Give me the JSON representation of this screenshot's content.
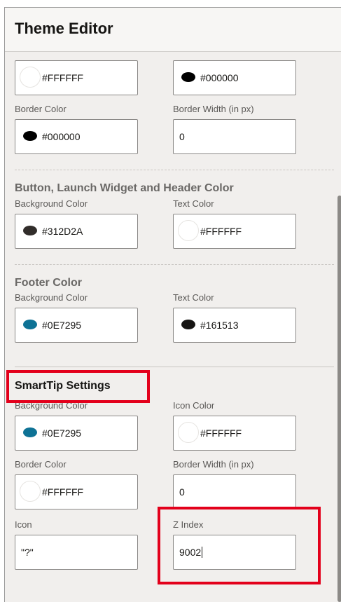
{
  "app": {
    "title": "Theme Editor"
  },
  "top_section": {
    "fields": [
      {
        "value": "#FFFFFF",
        "swatch_color": "#FFFFFF"
      },
      {
        "value": "#000000",
        "swatch_color": "#000000"
      }
    ],
    "border_color": {
      "label": "Border Color",
      "value": "#000000",
      "swatch_color": "#000000"
    },
    "border_width": {
      "label": "Border Width (in px)",
      "value": "0"
    }
  },
  "button_section": {
    "title": "Button, Launch Widget and Header Color",
    "background": {
      "label": "Background Color",
      "value": "#312D2A",
      "swatch_color": "#312D2A"
    },
    "text": {
      "label": "Text Color",
      "value": "#FFFFFF",
      "swatch_color": "#FFFFFF"
    }
  },
  "footer_section": {
    "title": "Footer Color",
    "background": {
      "label": "Background Color",
      "value": "#0E7295",
      "swatch_color": "#0E7295"
    },
    "text": {
      "label": "Text Color",
      "value": "#161513",
      "swatch_color": "#161513"
    }
  },
  "smarttip_section": {
    "title": "SmartTip Settings",
    "background": {
      "label": "Background Color",
      "value": "#0E7295",
      "swatch_color": "#0E7295"
    },
    "icon_color": {
      "label": "Icon Color",
      "value": "#FFFFFF",
      "swatch_color": "#FFFFFF"
    },
    "border_color": {
      "label": "Border Color",
      "value": "#FFFFFF",
      "swatch_color": "#FFFFFF"
    },
    "border_width": {
      "label": "Border Width (in px)",
      "value": "0"
    },
    "icon": {
      "label": "Icon",
      "value": "\"?\""
    },
    "z_index": {
      "label": "Z Index",
      "value": "9002"
    }
  },
  "highlight_color": "#E3001B"
}
